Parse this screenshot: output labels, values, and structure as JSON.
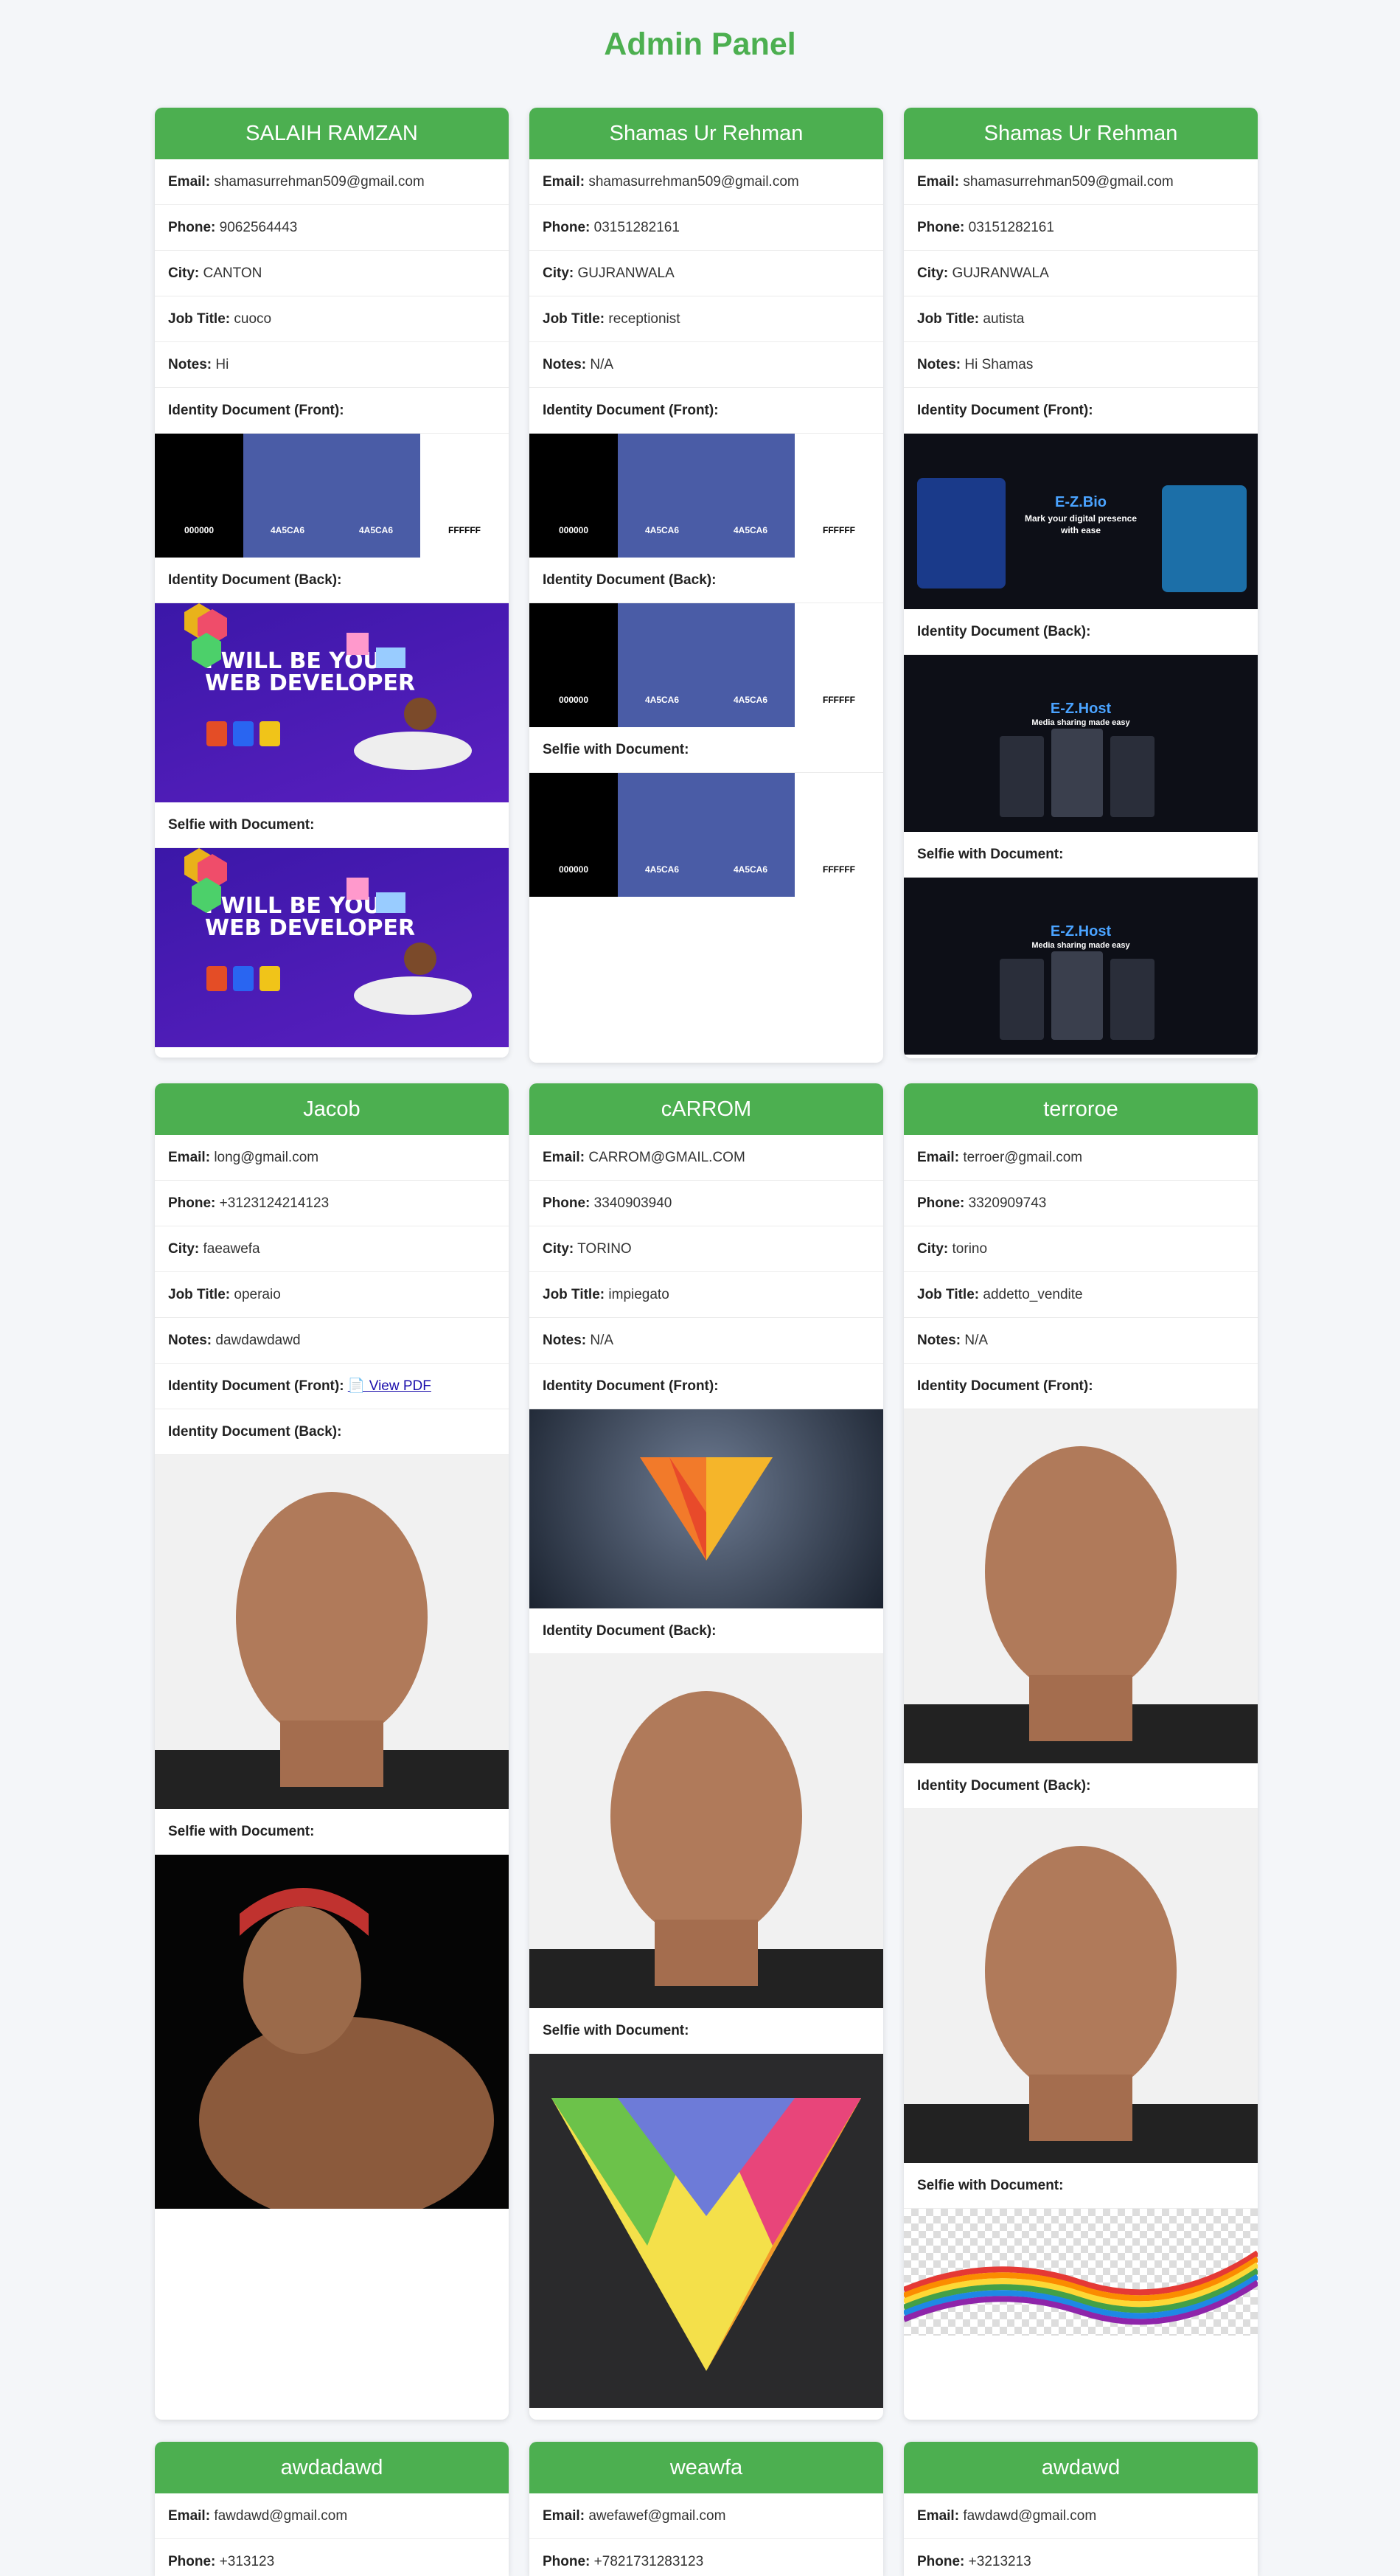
{
  "page": {
    "title": "Admin Panel"
  },
  "labels": {
    "email": "Email:",
    "phone": "Phone:",
    "city": "City:",
    "job_title": "Job Title:",
    "notes": "Notes:",
    "id_front": "Identity Document (Front):",
    "id_back": "Identity Document (Back):",
    "selfie": "Selfie with Document:",
    "view_pdf": "📄 View PDF"
  },
  "palette": {
    "c1": "000000",
    "c2": "4A5CA6",
    "c3": "4A5CA6",
    "c4": "FFFFFF"
  },
  "banner": {
    "line1": "I WILL BE YOUR",
    "line2": "WEB DEVELOPER"
  },
  "site1": {
    "brand": "E-Z.Bio",
    "tagline": "Mark your digital presence",
    "tagline2": "with ease"
  },
  "site2": {
    "brand": "E-Z.Host",
    "tagline": "Media sharing made easy"
  },
  "users": [
    {
      "name": "SALAIH RAMZAN",
      "email": "shamasurrehman509@gmail.com",
      "phone": "9062564443",
      "city": "CANTON",
      "job_title": "cuoco",
      "notes": "Hi"
    },
    {
      "name": "Shamas Ur Rehman",
      "email": "shamasurrehman509@gmail.com",
      "phone": "03151282161",
      "city": "GUJRANWALA",
      "job_title": "receptionist",
      "notes": "N/A"
    },
    {
      "name": "Shamas Ur Rehman",
      "email": "shamasurrehman509@gmail.com",
      "phone": "03151282161",
      "city": "GUJRANWALA",
      "job_title": "autista",
      "notes": "Hi Shamas"
    },
    {
      "name": "Jacob",
      "email": "long@gmail.com",
      "phone": "+3123124214123",
      "city": "faeawefa",
      "job_title": "operaio",
      "notes": "dawdawdawd"
    },
    {
      "name": "cARROM",
      "email": "CARROM@GMAIL.COM",
      "phone": "3340903940",
      "city": "TORINO",
      "job_title": "impiegato",
      "notes": "N/A"
    },
    {
      "name": "terroroe",
      "email": "terroer@gmail.com",
      "phone": "3320909743",
      "city": "torino",
      "job_title": "addetto_vendite",
      "notes": "N/A"
    },
    {
      "name": "awdadawd",
      "email": "fawdawd@gmail.com",
      "phone": "+313123"
    },
    {
      "name": "weawfa",
      "email": "awefawef@gmail.com",
      "phone": "+7821731283123"
    },
    {
      "name": "awdawd",
      "email": "fawdawd@gmail.com",
      "phone": "+3213213"
    }
  ]
}
